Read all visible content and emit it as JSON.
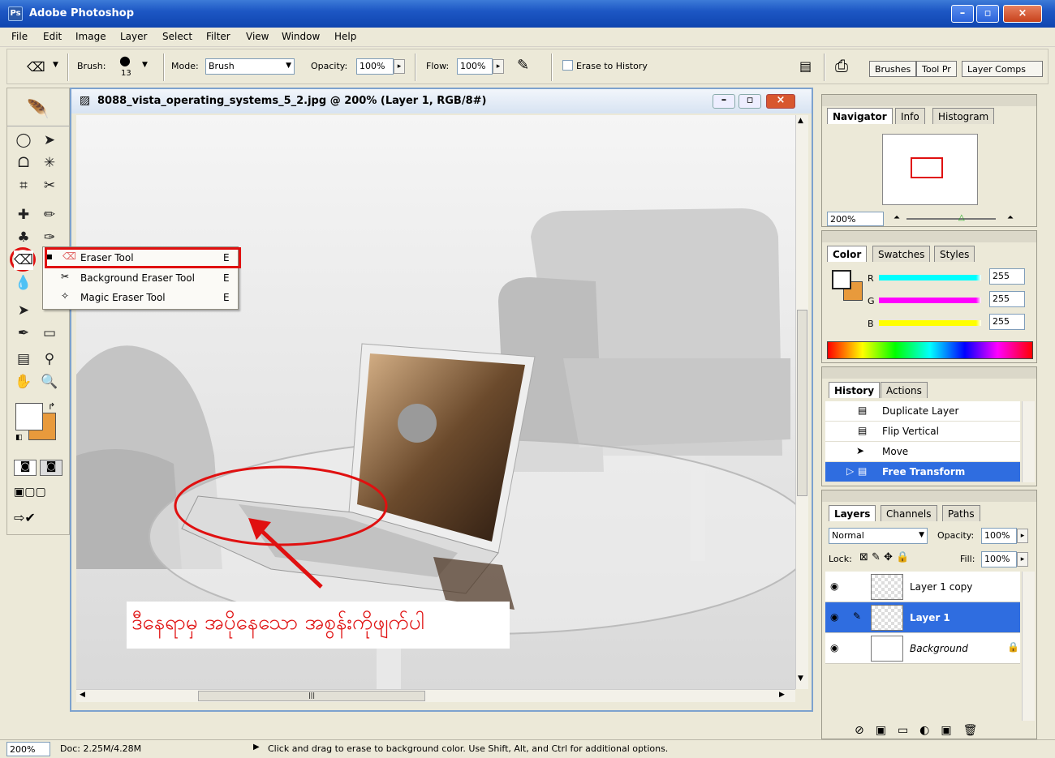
{
  "window": {
    "title": "Adobe Photoshop",
    "btn_min": "–",
    "btn_max": "▫",
    "btn_close": "×"
  },
  "menu": [
    "File",
    "Edit",
    "Image",
    "Layer",
    "Select",
    "Filter",
    "View",
    "Window",
    "Help"
  ],
  "options": {
    "brush_label": "Brush:",
    "brush_size": "13",
    "mode_label": "Mode:",
    "mode_value": "Brush",
    "opacity_label": "Opacity:",
    "opacity_value": "100%",
    "flow_label": "Flow:",
    "flow_value": "100%",
    "erase_history_label": "Erase to History",
    "palette_well_tabs": [
      "Brushes",
      "Tool Pr",
      "Layer Comps"
    ]
  },
  "document": {
    "title": "8088_vista_operating_systems_5_2.jpg @ 200% (Layer 1, RGB/8#)",
    "annotation": "ဒီနေရာမှ အပိုနေသော အစွန်းကိုဖျက်ပါ"
  },
  "flyout": [
    {
      "label": "Eraser Tool",
      "shortcut": "E"
    },
    {
      "label": "Background Eraser Tool",
      "shortcut": "E"
    },
    {
      "label": "Magic Eraser Tool",
      "shortcut": "E"
    }
  ],
  "navigator": {
    "tabs": [
      "Navigator",
      "Info",
      "Histogram"
    ],
    "zoom": "200%"
  },
  "color": {
    "tabs": [
      "Color",
      "Swatches",
      "Styles"
    ],
    "r_label": "R",
    "g_label": "G",
    "b_label": "B",
    "r": "255",
    "g": "255",
    "b": "255",
    "background_color": "#e89a3c"
  },
  "history": {
    "tabs": [
      "History",
      "Actions"
    ],
    "items": [
      "Duplicate Layer",
      "Flip Vertical",
      "Move",
      "Free Transform"
    ]
  },
  "layers": {
    "tabs": [
      "Layers",
      "Channels",
      "Paths"
    ],
    "blend_mode": "Normal",
    "opacity_label": "Opacity:",
    "opacity_value": "100%",
    "lock_label": "Lock:",
    "fill_label": "Fill:",
    "fill_value": "100%",
    "items": [
      "Layer 1 copy",
      "Layer 1",
      "Background"
    ]
  },
  "status": {
    "zoom": "200%",
    "doc": "Doc: 2.25M/4.28M",
    "hint": "Click and drag to erase to background color.  Use Shift, Alt, and Ctrl for additional options."
  },
  "colors": {
    "accent_selected": "#2f6de0",
    "highlight_red": "#e01010",
    "title_blue": "#1d57c4"
  }
}
